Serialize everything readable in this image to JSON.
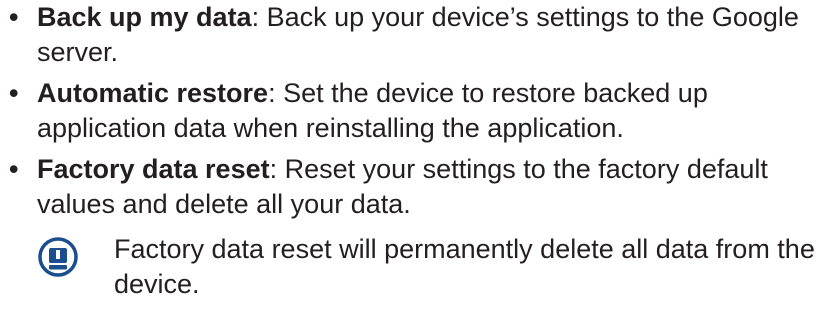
{
  "items": [
    {
      "bullet": "•",
      "term": "Back up my data",
      "separator": ":",
      "description": " Back up your device’s settings to the Google server."
    },
    {
      "bullet": "•",
      "term": "Automatic restore",
      "separator": ":",
      "description": " Set the device to restore backed up application data when reinstalling the application."
    },
    {
      "bullet": "•",
      "term": "Factory data reset",
      "separator": ":",
      "description": " Reset your settings to the factory default values and delete all your data."
    }
  ],
  "note": {
    "icon": "caution-icon",
    "text": "Factory data reset will permanently delete all data from the device."
  },
  "colors": {
    "text": "#231f20",
    "icon": "#1a4e8f"
  }
}
